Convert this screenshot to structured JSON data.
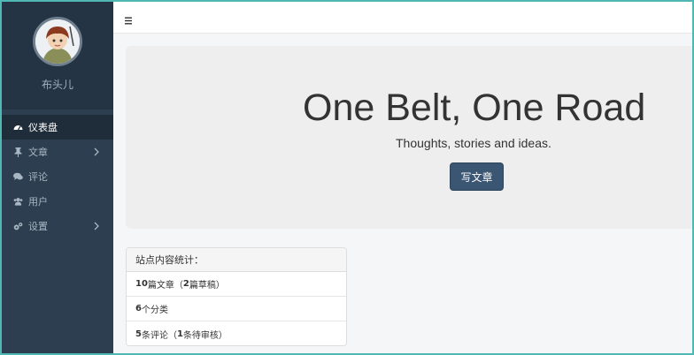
{
  "sidebar": {
    "profile_name": "布头儿",
    "items": [
      {
        "label": "仪表盘",
        "icon": "dashboard-icon",
        "active": true,
        "has_children": false
      },
      {
        "label": "文章",
        "icon": "thumbtack-icon",
        "active": false,
        "has_children": true
      },
      {
        "label": "评论",
        "icon": "comments-icon",
        "active": false,
        "has_children": false
      },
      {
        "label": "用户",
        "icon": "users-icon",
        "active": false,
        "has_children": false
      },
      {
        "label": "设置",
        "icon": "cogs-icon",
        "active": false,
        "has_children": true
      }
    ]
  },
  "topbar": {
    "menu_icon": "hamburger-icon"
  },
  "jumbotron": {
    "title": "One Belt, One Road",
    "subtitle": "Thoughts, stories and ideas.",
    "button_label": "写文章"
  },
  "stats": {
    "heading": "站点内容统计：",
    "rows": [
      {
        "count1": "10",
        "text1": "篇文章（",
        "count2": "2",
        "text2": "篇草稿）"
      },
      {
        "count1": "6",
        "text1": "个分类",
        "count2": "",
        "text2": ""
      },
      {
        "count1": "5",
        "text1": "条评论（",
        "count2": "1",
        "text2": "条待审核）"
      }
    ]
  },
  "colors": {
    "sidebar_bg": "#2d3e50",
    "sidebar_active": "#1f2d3b",
    "button_bg": "#3b5673",
    "jumbo_bg": "#eeeeee",
    "frame_border": "#4fb8b2"
  }
}
